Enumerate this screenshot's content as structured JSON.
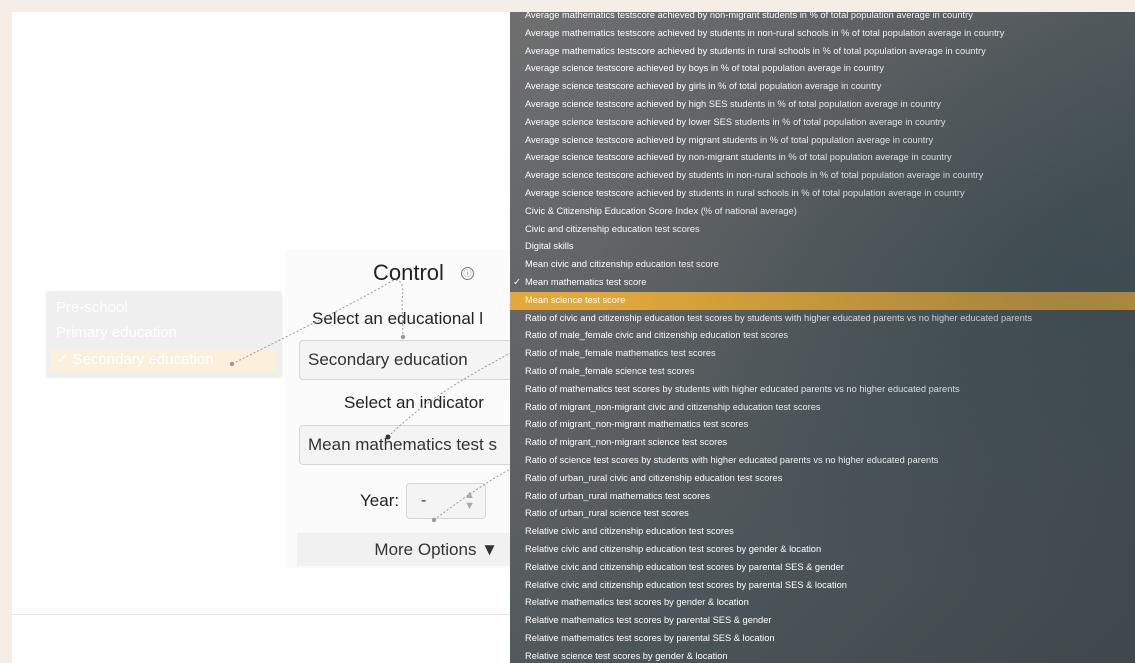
{
  "control": {
    "title": "Control",
    "info_icon": "ⓘ",
    "level_label": "Select an educational l",
    "level_value": "Secondary education",
    "indicator_label": "Select an indicator",
    "indicator_value": "Mean mathematics test s",
    "year_label": "Year:",
    "year_value": "-",
    "more_options": "More Options ▼"
  },
  "level_menu": {
    "items": [
      {
        "label": "Pre-school",
        "selected": false
      },
      {
        "label": "Primary education",
        "selected": false
      },
      {
        "label": "Secondary education",
        "selected": true
      }
    ],
    "check": "✓"
  },
  "indicator_menu": {
    "check": "✓",
    "options": [
      "Average mathematics testscore achieved by non-migrant students in % of total population average in country",
      "Average mathematics testscore achieved by students in non-rural schools in % of total population average in country",
      "Average mathematics testscore achieved by students in rural schools in % of total population average in country",
      "Average science testscore achieved by boys in % of total population average in country",
      "Average science testscore achieved by girls in % of total population average in country",
      "Average science testscore achieved by high SES students in % of total population average in country",
      "Average science testscore achieved by lower SES students in % of total population average in country",
      "Average science testscore achieved by migrant students in % of total population average in country",
      "Average science testscore achieved by non-migrant students in % of total population average in country",
      "Average science testscore achieved by students in non-rural schools in % of total population average in country",
      "Average science testscore achieved by students in rural schools in % of total population average in country",
      "Civic & Citizenship Education Score Index (% of national average)",
      "Civic and citizenship education test scores",
      "Digital skills",
      "Mean civic and citizenship education test score",
      "Mean mathematics test score",
      "Mean science test score",
      "Ratio of civic and citizenship education test scores by students with higher educated parents vs no higher educated parents",
      "Ratio of male_female civic and citizenship education test scores",
      "Ratio of male_female mathematics test scores",
      "Ratio of male_female science test scores",
      "Ratio of mathematics test scores by students with higher educated parents vs no higher educated parents",
      "Ratio of migrant_non-migrant civic and citizenship education test scores",
      "Ratio of migrant_non-migrant mathematics test scores",
      "Ratio of migrant_non-migrant science test scores",
      "Ratio of science test scores by students with higher educated parents vs no higher educated parents",
      "Ratio of urban_rural civic and citizenship education test scores",
      "Ratio of urban_rural mathematics test scores",
      "Ratio of urban_rural science test scores",
      "Relative civic and citizenship education test scores",
      "Relative civic and citizenship education test scores by gender & location",
      "Relative civic and citizenship education test scores by parental SES & gender",
      "Relative civic and citizenship education test scores by parental SES & location",
      "Relative mathematics test scores by gender & location",
      "Relative mathematics test scores by parental SES & gender",
      "Relative mathematics test scores by parental SES & location",
      "Relative science test scores by gender & location"
    ],
    "checked_index": 15,
    "highlight_index": 16
  },
  "colors": {
    "highlight": "#e3a83a",
    "page_bg": "#f6ede6"
  }
}
